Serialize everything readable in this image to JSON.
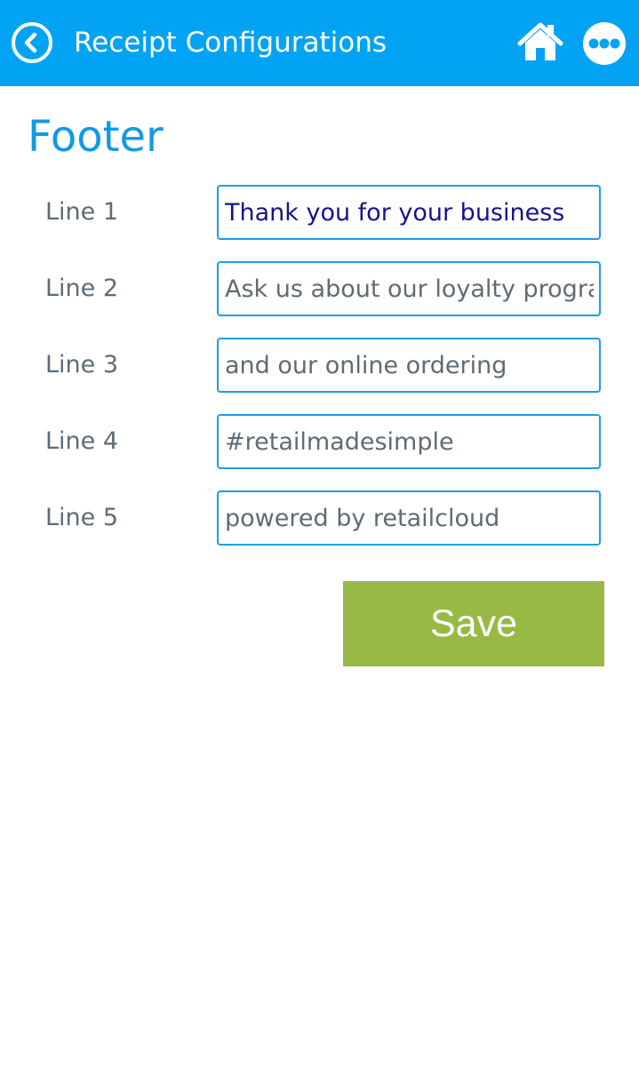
{
  "app_bar": {
    "title": "Receipt Configurations",
    "back_icon": "back-circle-icon",
    "home_icon": "home-icon",
    "more_icon": "more-dots-icon",
    "background_color": "#03a3f4"
  },
  "section": {
    "title": "Footer"
  },
  "lines": [
    {
      "label": "Line 1",
      "value": "Thank you for your business"
    },
    {
      "label": "Line 2",
      "value": "Ask us about our loyalty program"
    },
    {
      "label": "Line 3",
      "value": "and our online ordering"
    },
    {
      "label": "Line 4",
      "value": "#retailmadesimple"
    },
    {
      "label": "Line 5",
      "value": "powered by retailcloud"
    }
  ],
  "save_button": {
    "label": "Save",
    "color": "#98b944"
  }
}
